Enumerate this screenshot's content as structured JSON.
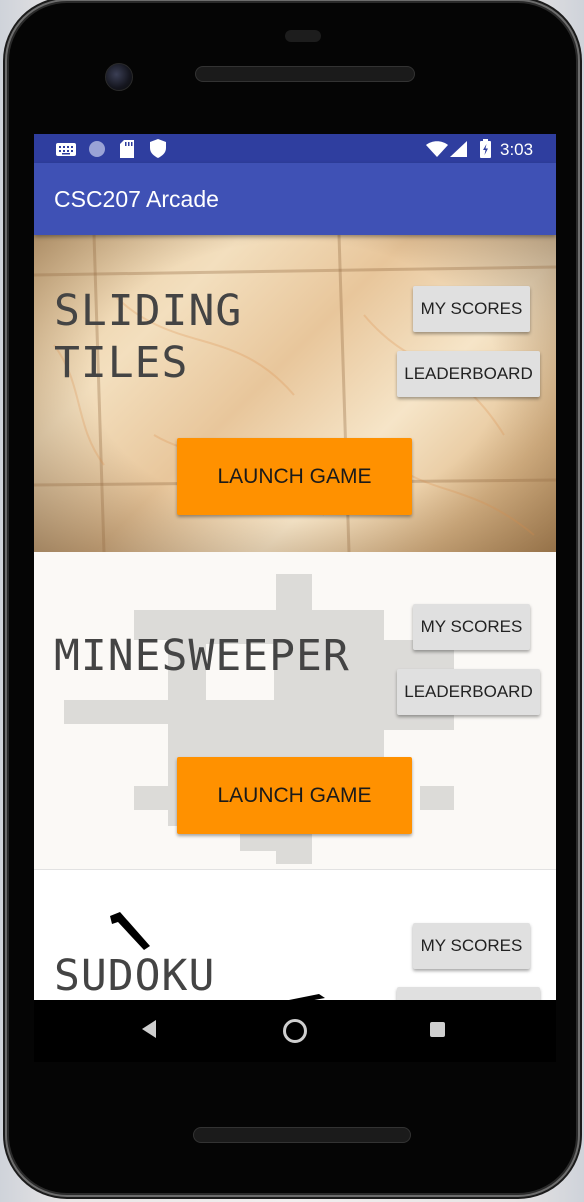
{
  "status_bar": {
    "time": "3:03",
    "left_icons": [
      "keyboard-icon",
      "circle-icon",
      "sd-card-icon",
      "shield-icon"
    ],
    "right_icons": [
      "wifi-icon",
      "signal-icon",
      "battery-icon"
    ]
  },
  "app_bar": {
    "title": "CSC207 Arcade"
  },
  "games": [
    {
      "title_line1": "SLIDING",
      "title_line2": "TILES",
      "scores_label": "MY SCORES",
      "leaderboard_label": "LEADERBOARD",
      "launch_label": "LAUNCH GAME"
    },
    {
      "title_line1": "MINESWEEPER",
      "scores_label": "MY SCORES",
      "leaderboard_label": "LEADERBOARD",
      "launch_label": "LAUNCH GAME"
    },
    {
      "title_line1": "SUDOKU",
      "scores_label": "MY SCORES"
    }
  ],
  "nav_bar": {
    "icons": [
      "back-icon",
      "home-icon",
      "recents-icon"
    ]
  },
  "colors": {
    "status_bar": "#2f3e9f",
    "app_bar": "#3f51b5",
    "launch_button": "#ff9100",
    "secondary_button": "#e0e0e0"
  }
}
